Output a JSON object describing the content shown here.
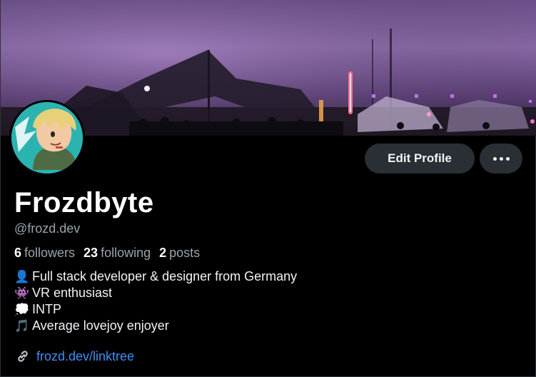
{
  "profile": {
    "display_name": "Frozdbyte",
    "handle": "@frozd.dev",
    "stats": {
      "followers_count": "6",
      "followers_label": "followers",
      "following_count": "23",
      "following_label": "following",
      "posts_count": "2",
      "posts_label": "posts"
    },
    "bio": [
      {
        "icon": "person-icon",
        "glyph": "👤",
        "text": "Full stack developer & designer from Germany"
      },
      {
        "icon": "alien-invader-icon",
        "glyph": "👾",
        "text": "VR enthusiast"
      },
      {
        "icon": "thought-bubble-icon",
        "glyph": "💭",
        "text": "INTP"
      },
      {
        "icon": "music-note-icon",
        "glyph": "🎵",
        "text": "Average lovejoy enjoyer"
      }
    ],
    "link": {
      "icon": "link-icon",
      "text": "frozd.dev/linktree"
    }
  },
  "actions": {
    "edit_label": "Edit Profile",
    "more_icon": "more-options-icon"
  },
  "colors": {
    "background": "#000000",
    "button_bg": "#2a2f35",
    "link": "#3f8ef5",
    "muted_text": "#9aa3ad",
    "avatar_bg": "#2bb3b0"
  }
}
